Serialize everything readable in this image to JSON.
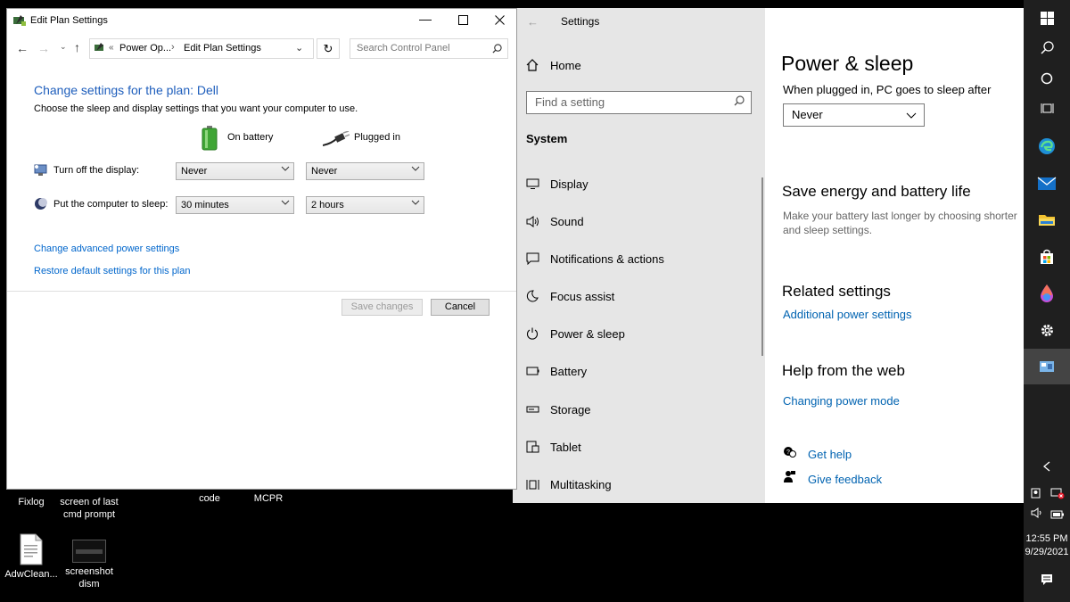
{
  "desktop": {
    "icons": [
      {
        "label": "Fixlog"
      },
      {
        "label": "screen of last cmd prompt"
      },
      {
        "label": "code"
      },
      {
        "label": "MCPR"
      },
      {
        "label": "AdwClean..."
      },
      {
        "label": "screenshot dism"
      }
    ]
  },
  "edit_window": {
    "title": "Edit Plan Settings",
    "breadcrumb_prefix": "«",
    "breadcrumb_1": "Power Op...",
    "breadcrumb_sep": "›",
    "breadcrumb_2": "Edit Plan Settings",
    "search_placeholder": "Search Control Panel",
    "heading": "Change settings for the plan: Dell",
    "subheading": "Choose the sleep and display settings that you want your computer to use.",
    "col_battery": "On battery",
    "col_plugged": "Plugged in",
    "row_display_label": "Turn off the display:",
    "row_display_battery": "Never",
    "row_display_plugged": "Never",
    "row_sleep_label": "Put the computer to sleep:",
    "row_sleep_battery": "30 minutes",
    "row_sleep_plugged": "2 hours",
    "link_advanced": "Change advanced power settings",
    "link_restore": "Restore default settings for this plan",
    "btn_save": "Save changes",
    "btn_cancel": "Cancel"
  },
  "settings_window": {
    "title": "Settings",
    "home": "Home",
    "find_placeholder": "Find a setting",
    "section": "System",
    "nav": [
      {
        "label": "Display",
        "icon": "display-icon"
      },
      {
        "label": "Sound",
        "icon": "sound-icon"
      },
      {
        "label": "Notifications & actions",
        "icon": "notifications-icon"
      },
      {
        "label": "Focus assist",
        "icon": "moon-icon"
      },
      {
        "label": "Power & sleep",
        "icon": "power-icon"
      },
      {
        "label": "Battery",
        "icon": "battery-icon"
      },
      {
        "label": "Storage",
        "icon": "storage-icon"
      },
      {
        "label": "Tablet",
        "icon": "tablet-icon"
      },
      {
        "label": "Multitasking",
        "icon": "multitasking-icon"
      }
    ],
    "page_title": "Power & sleep",
    "plugged_sleep_label": "When plugged in, PC goes to sleep after",
    "plugged_sleep_value": "Never",
    "save_title": "Save energy and battery life",
    "save_desc": "Make your battery last longer by choosing shorter times for screen and sleep settings.",
    "save_desc_line1": "Make your battery last longer by choosing shorter",
    "save_desc_line2": "and sleep settings.",
    "related_title": "Related settings",
    "related_link": "Additional power settings",
    "help_title": "Help from the web",
    "help_link": "Changing power mode",
    "get_help": "Get help",
    "give_feedback": "Give feedback"
  },
  "taskbar": {
    "time": "12:55 PM",
    "date": "9/29/2021"
  },
  "colors": {
    "accent_link": "#0063b1",
    "cp_heading": "#1e5ebc",
    "taskbar": "#1f1f1f",
    "settings_sidebar": "#e6e6e6"
  }
}
